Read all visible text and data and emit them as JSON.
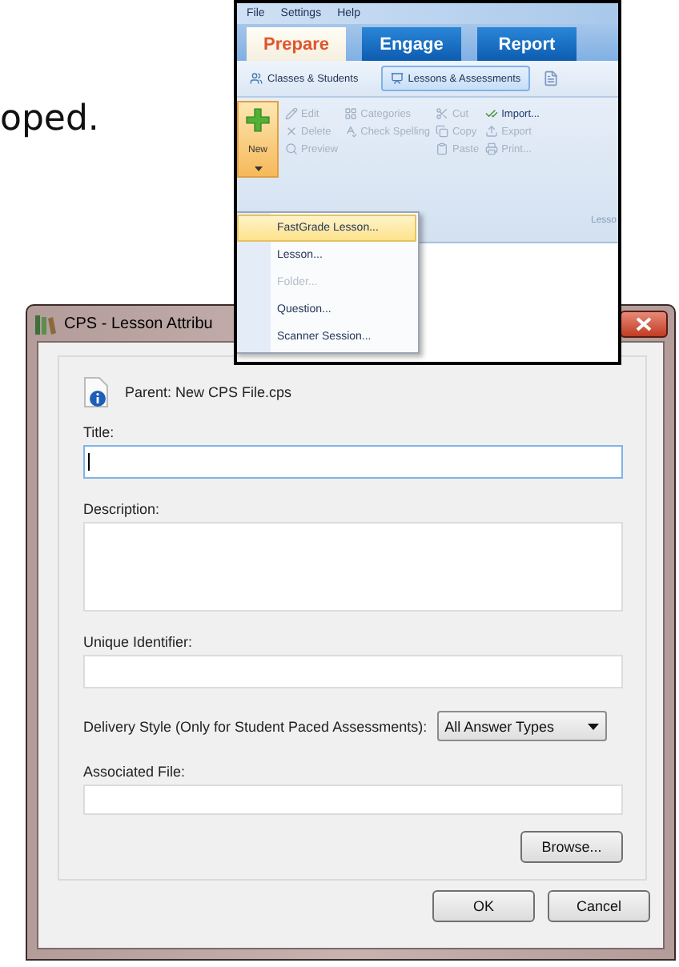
{
  "document_text": "oped.",
  "app_window": {
    "menu": [
      "File",
      "Settings",
      "Help"
    ],
    "tabs": [
      {
        "label": "Prepare",
        "selected": true
      },
      {
        "label": "Engage",
        "selected": false
      },
      {
        "label": "Report",
        "selected": false
      }
    ],
    "subtabs": [
      {
        "label": "Classes & Students",
        "selected": false
      },
      {
        "label": "Lessons & Assessments",
        "selected": true
      }
    ],
    "ribbon": {
      "new_button": "New",
      "columns": [
        [
          {
            "label": "Edit",
            "disabled": true
          },
          {
            "label": "Delete",
            "disabled": true
          },
          {
            "label": "Preview",
            "disabled": true
          }
        ],
        [
          {
            "label": "Categories",
            "disabled": true
          },
          {
            "label": "Check Spelling",
            "disabled": true
          }
        ],
        [
          {
            "label": "Cut",
            "disabled": true
          },
          {
            "label": "Copy",
            "disabled": true
          },
          {
            "label": "Paste",
            "disabled": true
          }
        ],
        [
          {
            "label": "Import...",
            "disabled": false
          },
          {
            "label": "Export",
            "disabled": true
          },
          {
            "label": "Print...",
            "disabled": true
          }
        ]
      ],
      "group_label": "Lesso"
    },
    "new_menu": [
      {
        "label": "FastGrade Lesson...",
        "selected": true,
        "disabled": false
      },
      {
        "label": "Lesson...",
        "selected": false,
        "disabled": false
      },
      {
        "label": "Folder...",
        "selected": false,
        "disabled": true
      },
      {
        "label": "Question...",
        "selected": false,
        "disabled": false
      },
      {
        "label": "Scanner Session...",
        "selected": false,
        "disabled": false
      }
    ]
  },
  "dialog": {
    "title": "CPS - Lesson Attribu",
    "parent": "Parent: New CPS File.cps",
    "fields": [
      {
        "kind": "text",
        "label": "Title:",
        "focused": true
      },
      {
        "kind": "textarea",
        "label": "Description:",
        "focused": false
      },
      {
        "kind": "text",
        "label": "Unique Identifier:",
        "focused": false
      },
      {
        "kind": "select",
        "label": "Delivery Style (Only for Student Paced Assessments):",
        "value": "All Answer Types"
      },
      {
        "kind": "file",
        "label": "Associated File:",
        "focused": false,
        "button": "Browse..."
      }
    ],
    "buttons": [
      "OK",
      "Cancel"
    ]
  }
}
